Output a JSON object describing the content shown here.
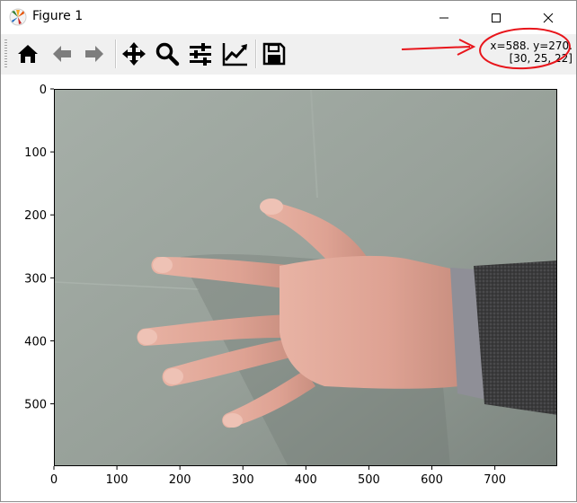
{
  "window": {
    "title": "Figure 1"
  },
  "toolbar": {
    "buttons": [
      {
        "name": "home",
        "icon": "home-icon"
      },
      {
        "name": "back",
        "icon": "arrow-left-icon"
      },
      {
        "name": "forward",
        "icon": "arrow-right-icon"
      },
      {
        "name": "pan",
        "icon": "move-icon"
      },
      {
        "name": "zoom",
        "icon": "magnifier-icon"
      },
      {
        "name": "configure-subplots",
        "icon": "sliders-icon"
      },
      {
        "name": "edit-axis",
        "icon": "line-chart-icon"
      },
      {
        "name": "save",
        "icon": "floppy-disk-icon"
      }
    ],
    "coord_line1": "x=588. y=270.",
    "coord_line2": "[30, 25, 22]"
  },
  "plot": {
    "x_ticks": [
      "0",
      "100",
      "200",
      "300",
      "400",
      "500",
      "600",
      "700"
    ],
    "y_ticks": [
      "0",
      "100",
      "200",
      "300",
      "400",
      "500"
    ],
    "x_range": [
      0,
      799
    ],
    "y_range": [
      0,
      599
    ],
    "image_content": "hand-photo"
  },
  "colors": {
    "annotation": "#e8151b",
    "background_gray_green": "#9aa39c"
  }
}
